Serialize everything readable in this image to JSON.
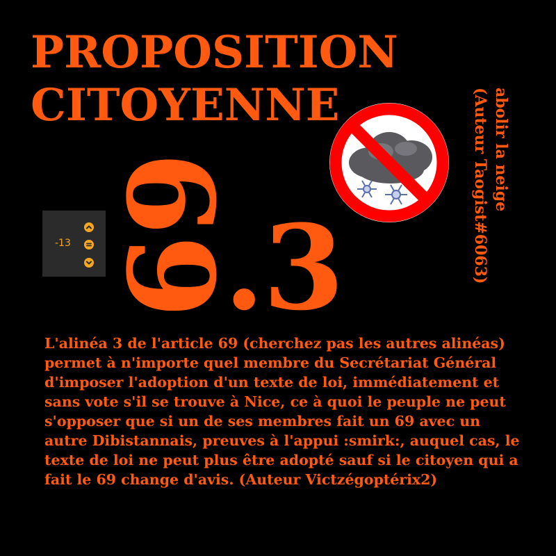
{
  "title": {
    "line1": "PROPOSITION",
    "line2": "CITOYENNE"
  },
  "side": {
    "line1": "abolir la neige",
    "line2": "(Auteur Taogist#6063)"
  },
  "number": {
    "article": "69",
    "paragraph": ".3"
  },
  "vote": {
    "score": "-13",
    "up_icon": "chevron-up-icon",
    "neutral_icon": "equals-icon",
    "down_icon": "chevron-down-icon"
  },
  "image": {
    "icon": "no-snow-cloud-icon"
  },
  "body": {
    "text": "L'alinéa 3 de l'article 69 (cherchez pas les autres alinéas) permet à n'importe quel membre du Secrétariat Général d'imposer l'adoption d'un texte de loi, immédiatement et sans vote s'il se trouve à Nice, ce à quoi le peuple ne peut s'opposer que si un de ses membres fait un 69 avec un autre Dibistannais, preuves à l'appui :smirk:, auquel cas, le texte de loi ne peut plus être adopté sauf si le citoyen qui a fait le 69 change d'avis. (Auteur Victzégoptérix2)"
  },
  "colors": {
    "background": "#000000",
    "accent": "#ff5a0f",
    "vote_text": "#f5a623",
    "vote_panel": "#2b2b2b",
    "prohibition_red": "#ff0000"
  }
}
